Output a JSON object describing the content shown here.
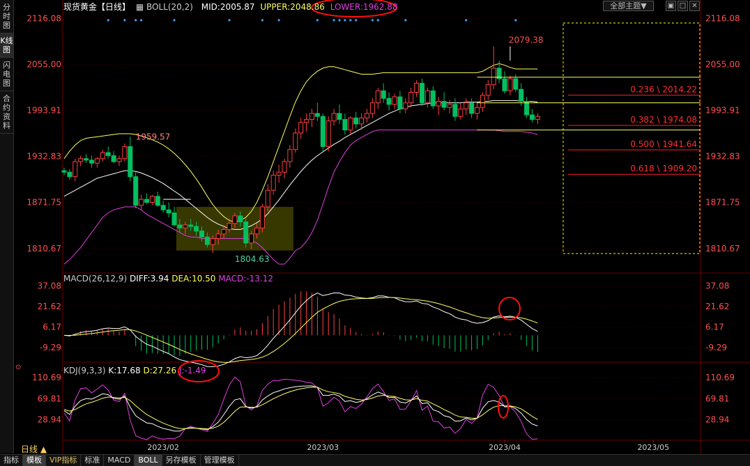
{
  "left_tabs": [
    "分时图",
    "K线图",
    "闪电图",
    "合约资料"
  ],
  "header": {
    "title": "现货黄金【日线】",
    "boll_label": "BOLL(20,2)",
    "mid": "MID:2005.87",
    "upper": "UPPER:2048.86",
    "lower": "LOWER:1962.88",
    "theme_button": "全部主题▼",
    "icons": [
      "restore-icon",
      "maximize-icon",
      "close-icon"
    ]
  },
  "macd_header": {
    "name": "MACD(26,12,9)",
    "diff": "DIFF:3.94",
    "dea": "DEA:10.50",
    "macd": "MACD:-13.12"
  },
  "kdj_header": {
    "name": "KDJ(9,3,3)",
    "k": "K:17.68",
    "d": "D:27.26",
    "j": "J:-1.49"
  },
  "annotations": {
    "high_label": "2079.38",
    "low_label": "1804.63",
    "local_high_label": "1959.57"
  },
  "fibonacci": [
    "0.236 \\ 2014.22",
    "0.382 \\ 1974.08",
    "0.500 \\ 1941.64",
    "0.618 \\ 1909.20"
  ],
  "period_label": "日线 ▲",
  "bottom_tabs": [
    "指标",
    "模板",
    "VIP指标",
    "标准",
    "MACD",
    "BOLL",
    "另存模板",
    "管理模板"
  ],
  "colors": {
    "up": "#ff4040",
    "down": "#00c060",
    "mid": "#ffffff",
    "upper": "#ffff60",
    "lower": "#e040e0",
    "grid": "#3a0000",
    "axis_text": "#ff5050",
    "volume_box": "#4a4a00"
  },
  "chart_data": [
    {
      "type": "candlestick",
      "title": "现货黄金【日线】",
      "y_ticks": [
        "2116.08",
        "2055.00",
        "1993.91",
        "1932.83",
        "1871.75",
        "1810.67"
      ],
      "ylim": [
        1780,
        2122
      ],
      "x_ticks": [
        "2023/02",
        "2023/03",
        "2023/04",
        "2023/05"
      ],
      "x_tick_index": [
        18,
        47,
        80,
        107
      ],
      "candles": [
        [
          1914,
          1918,
          1908,
          1912
        ],
        [
          1912,
          1916,
          1902,
          1906
        ],
        [
          1906,
          1930,
          1900,
          1926
        ],
        [
          1926,
          1934,
          1920,
          1930
        ],
        [
          1930,
          1936,
          1924,
          1928
        ],
        [
          1928,
          1934,
          1918,
          1924
        ],
        [
          1924,
          1932,
          1918,
          1930
        ],
        [
          1930,
          1942,
          1926,
          1938
        ],
        [
          1938,
          1946,
          1930,
          1934
        ],
        [
          1934,
          1940,
          1924,
          1926
        ],
        [
          1926,
          1934,
          1920,
          1930
        ],
        [
          1930,
          1950,
          1926,
          1946
        ],
        [
          1946,
          1959,
          1900,
          1906
        ],
        [
          1906,
          1912,
          1864,
          1868
        ],
        [
          1868,
          1882,
          1862,
          1876
        ],
        [
          1876,
          1884,
          1870,
          1872
        ],
        [
          1872,
          1882,
          1868,
          1880
        ],
        [
          1880,
          1886,
          1866,
          1868
        ],
        [
          1868,
          1874,
          1858,
          1862
        ],
        [
          1862,
          1872,
          1852,
          1858
        ],
        [
          1858,
          1866,
          1840,
          1842
        ],
        [
          1842,
          1850,
          1832,
          1838
        ],
        [
          1838,
          1846,
          1830,
          1842
        ],
        [
          1842,
          1850,
          1834,
          1840
        ],
        [
          1840,
          1846,
          1828,
          1834
        ],
        [
          1834,
          1840,
          1820,
          1826
        ],
        [
          1826,
          1832,
          1812,
          1816
        ],
        [
          1816,
          1828,
          1805,
          1824
        ],
        [
          1824,
          1836,
          1816,
          1830
        ],
        [
          1830,
          1842,
          1824,
          1836
        ],
        [
          1836,
          1850,
          1832,
          1844
        ],
        [
          1844,
          1858,
          1838,
          1854
        ],
        [
          1854,
          1860,
          1840,
          1846
        ],
        [
          1846,
          1850,
          1812,
          1818
        ],
        [
          1818,
          1834,
          1810,
          1830
        ],
        [
          1830,
          1844,
          1824,
          1838
        ],
        [
          1838,
          1870,
          1832,
          1866
        ],
        [
          1866,
          1896,
          1860,
          1888
        ],
        [
          1888,
          1914,
          1882,
          1908
        ],
        [
          1908,
          1922,
          1898,
          1912
        ],
        [
          1912,
          1930,
          1904,
          1926
        ],
        [
          1926,
          1948,
          1918,
          1942
        ],
        [
          1942,
          1970,
          1938,
          1964
        ],
        [
          1964,
          1984,
          1956,
          1978
        ],
        [
          1978,
          1990,
          1966,
          1982
        ],
        [
          1982,
          1996,
          1972,
          1990
        ],
        [
          1990,
          2004,
          1980,
          1986
        ],
        [
          1986,
          1990,
          1940,
          1946
        ],
        [
          1946,
          1986,
          1940,
          1980
        ],
        [
          1980,
          1996,
          1974,
          1990
        ],
        [
          1990,
          2002,
          1976,
          1982
        ],
        [
          1982,
          1990,
          1962,
          1968
        ],
        [
          1968,
          1986,
          1962,
          1984
        ],
        [
          1984,
          1992,
          1970,
          1976
        ],
        [
          1976,
          1990,
          1968,
          1984
        ],
        [
          1984,
          1996,
          1978,
          1990
        ],
        [
          1990,
          2010,
          1984,
          2004
        ],
        [
          2004,
          2024,
          1996,
          2020
        ],
        [
          2020,
          2030,
          2004,
          2010
        ],
        [
          2010,
          2018,
          1994,
          2002
        ],
        [
          2002,
          2016,
          1996,
          2012
        ],
        [
          2012,
          2020,
          1990,
          1996
        ],
        [
          1996,
          2010,
          1990,
          2004
        ],
        [
          2004,
          2024,
          1998,
          2018
        ],
        [
          2018,
          2034,
          2012,
          2030
        ],
        [
          2030,
          2036,
          2000,
          2004
        ],
        [
          2004,
          2024,
          1998,
          2020
        ],
        [
          2020,
          2026,
          1996,
          2000
        ],
        [
          2000,
          2012,
          1988,
          2006
        ],
        [
          2006,
          2018,
          1994,
          1998
        ],
        [
          1998,
          2008,
          1990,
          2002
        ],
        [
          2002,
          2010,
          1980,
          1986
        ],
        [
          1986,
          2004,
          1982,
          1996
        ],
        [
          1996,
          2010,
          1988,
          2004
        ],
        [
          2004,
          2010,
          1984,
          1990
        ],
        [
          1990,
          2004,
          1982,
          1998
        ],
        [
          1998,
          2018,
          1992,
          2014
        ],
        [
          2014,
          2034,
          2008,
          2028
        ],
        [
          2028,
          2079,
          2022,
          2050
        ],
        [
          2050,
          2060,
          2030,
          2036
        ],
        [
          2036,
          2046,
          2016,
          2020
        ],
        [
          2020,
          2040,
          2014,
          2036
        ],
        [
          2036,
          2042,
          2018,
          2022
        ],
        [
          2022,
          2030,
          2000,
          2006
        ],
        [
          2006,
          2012,
          1984,
          1988
        ],
        [
          1988,
          1996,
          1978,
          1982
        ],
        [
          1982,
          1990,
          1976,
          1986
        ]
      ],
      "mid": [
        1880,
        1884,
        1888,
        1892,
        1896,
        1900,
        1904,
        1906,
        1908,
        1910,
        1912,
        1914,
        1914,
        1913,
        1911,
        1908,
        1905,
        1901,
        1897,
        1892,
        1887,
        1882,
        1876,
        1870,
        1864,
        1858,
        1852,
        1847,
        1843,
        1840,
        1837,
        1836,
        1836,
        1838,
        1841,
        1845,
        1850,
        1857,
        1866,
        1875,
        1885,
        1895,
        1904,
        1913,
        1921,
        1928,
        1934,
        1939,
        1944,
        1949,
        1953,
        1958,
        1962,
        1966,
        1970,
        1974,
        1978,
        1982,
        1986,
        1990,
        1993,
        1996,
        1998,
        2000,
        2001,
        2002,
        2003,
        2004,
        2004,
        2004,
        2004,
        2004,
        2004,
        2005,
        2005,
        2005,
        2006,
        2006,
        2007,
        2007,
        2007,
        2007,
        2007,
        2006,
        2006,
        2006,
        2005
      ],
      "upper": [
        1930,
        1940,
        1948,
        1954,
        1957,
        1958,
        1959,
        1960,
        1961,
        1962,
        1963,
        1963,
        1963,
        1962,
        1960,
        1958,
        1955,
        1952,
        1948,
        1943,
        1937,
        1930,
        1922,
        1913,
        1903,
        1892,
        1880,
        1869,
        1860,
        1853,
        1848,
        1846,
        1848,
        1852,
        1860,
        1872,
        1888,
        1906,
        1926,
        1946,
        1966,
        1986,
        2005,
        2020,
        2032,
        2040,
        2046,
        2050,
        2052,
        2052,
        2050,
        2048,
        2046,
        2044,
        2042,
        2042,
        2042,
        2043,
        2044,
        2044,
        2044,
        2044,
        2044,
        2044,
        2044,
        2044,
        2044,
        2044,
        2044,
        2044,
        2044,
        2044,
        2044,
        2044,
        2044,
        2044,
        2046,
        2050,
        2054,
        2056,
        2054,
        2051,
        2049,
        2049,
        2049,
        2049,
        2049
      ],
      "lower": [
        1790,
        1796,
        1804,
        1812,
        1822,
        1832,
        1842,
        1852,
        1858,
        1862,
        1864,
        1866,
        1866,
        1866,
        1862,
        1856,
        1852,
        1848,
        1844,
        1840,
        1836,
        1832,
        1828,
        1826,
        1826,
        1824,
        1824,
        1824,
        1824,
        1824,
        1824,
        1824,
        1824,
        1824,
        1822,
        1818,
        1812,
        1804,
        1796,
        1790,
        1790,
        1798,
        1808,
        1812,
        1820,
        1832,
        1848,
        1870,
        1892,
        1912,
        1926,
        1938,
        1948,
        1954,
        1958,
        1962,
        1966,
        1968,
        1968,
        1968,
        1968,
        1968,
        1968,
        1968,
        1968,
        1968,
        1968,
        1968,
        1968,
        1968,
        1968,
        1968,
        1968,
        1968,
        1968,
        1968,
        1968,
        1968,
        1968,
        1967,
        1966,
        1966,
        1966,
        1966,
        1965,
        1964,
        1962
      ],
      "series": [
        {
          "name": "MID",
          "value": "2005.87"
        },
        {
          "name": "UPPER",
          "value": "2048.86"
        },
        {
          "name": "LOWER",
          "value": "1962.88"
        }
      ],
      "fib_levels": [
        2014.22,
        1974.08,
        1941.64,
        1909.2
      ]
    },
    {
      "type": "line",
      "title": "MACD(26,12,9)",
      "y_ticks": [
        "37.08",
        "21.62",
        "6.17",
        "-9.29"
      ],
      "ylim": [
        -15,
        40
      ],
      "series": [
        {
          "name": "DIFF",
          "value": "3.94"
        },
        {
          "name": "DEA",
          "value": "10.50"
        },
        {
          "name": "MACD",
          "value": "-13.12"
        }
      ]
    },
    {
      "type": "line",
      "title": "KDJ(9,3,3)",
      "y_ticks": [
        "110.69",
        "69.81",
        "28.94"
      ],
      "ylim": [
        -5,
        120
      ],
      "series": [
        {
          "name": "K",
          "value": "17.68"
        },
        {
          "name": "D",
          "value": "27.26"
        },
        {
          "name": "J",
          "value": "-1.49"
        }
      ]
    }
  ]
}
